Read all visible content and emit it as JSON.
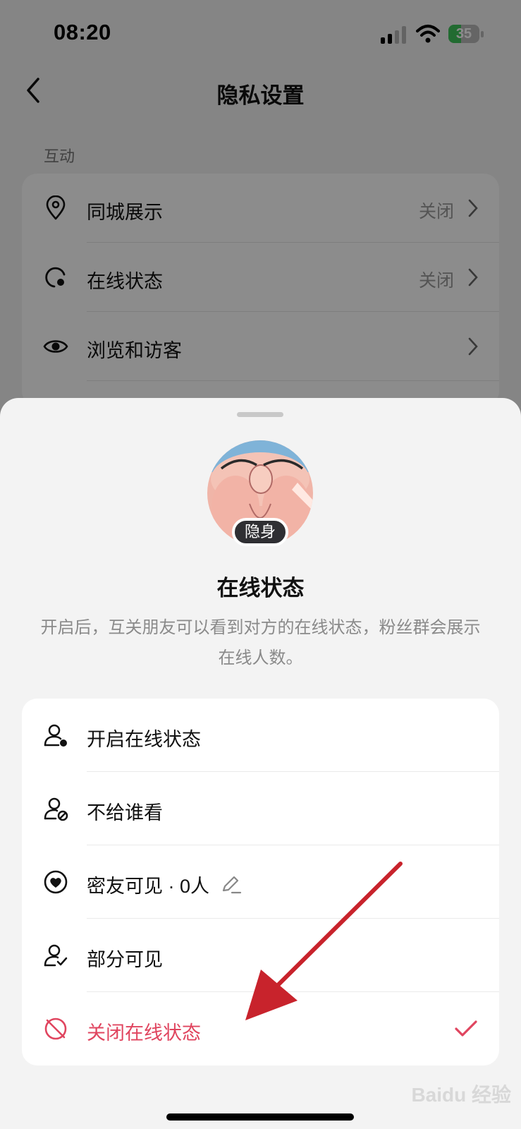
{
  "status_bar": {
    "time": "08:20",
    "battery": "35",
    "battery_level": 0.35
  },
  "nav": {
    "title": "隐私设置"
  },
  "interaction_section": {
    "label": "互动",
    "items": [
      {
        "label": "同城展示",
        "value": "关闭",
        "icon": "location-pin-icon"
      },
      {
        "label": "在线状态",
        "value": "关闭",
        "icon": "online-status-icon"
      },
      {
        "label": "浏览和访客",
        "value": "",
        "icon": "eye-icon"
      }
    ]
  },
  "sheet": {
    "badge": "隐身",
    "title": "在线状态",
    "description": "开启后，互关朋友可以看到对方的在线状态，粉丝群会展示在线人数。",
    "options": [
      {
        "label": "开启在线状态",
        "icon": "user-online-icon",
        "selected": false
      },
      {
        "label": "不给谁看",
        "icon": "user-block-icon",
        "selected": false
      },
      {
        "label": "密友可见 · 0人",
        "icon": "heart-circle-icon",
        "selected": false
      },
      {
        "label": "部分可见",
        "icon": "user-check-icon",
        "selected": false
      },
      {
        "label": "关闭在线状态",
        "icon": "status-off-icon",
        "selected": true
      }
    ]
  },
  "watermark": "Baidu 经验",
  "colors": {
    "accent": "#e0455f",
    "annotation_arrow": "#c8232c"
  }
}
